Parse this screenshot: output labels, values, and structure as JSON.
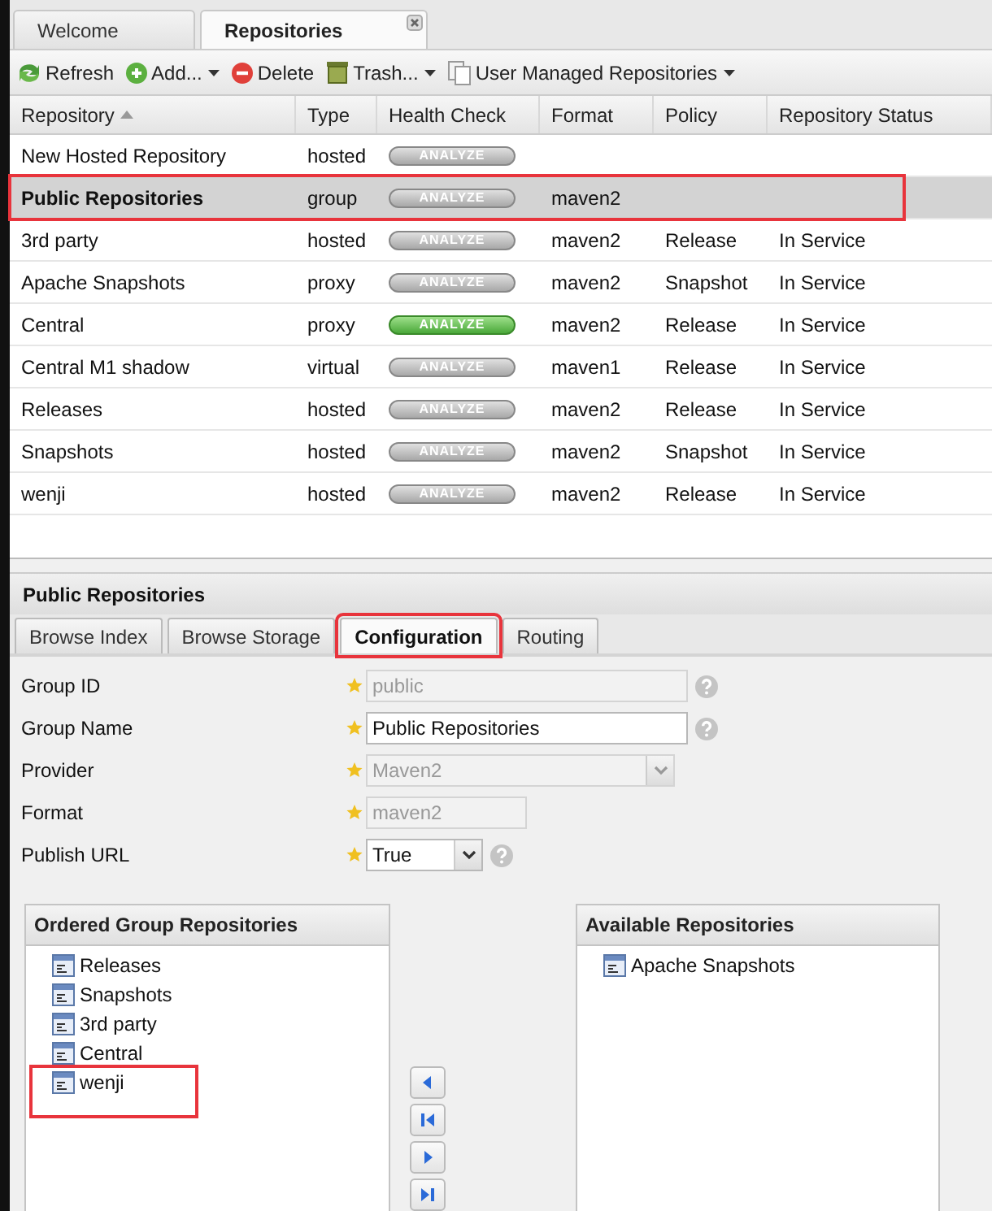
{
  "main_tabs": [
    {
      "label": "Welcome",
      "selected": false,
      "closable": false
    },
    {
      "label": "Repositories",
      "selected": true,
      "closable": true
    }
  ],
  "toolbar": [
    {
      "label": "Refresh",
      "dropdown": false
    },
    {
      "label": "Add...",
      "dropdown": true
    },
    {
      "label": "Delete",
      "dropdown": false
    },
    {
      "label": "Trash...",
      "dropdown": true
    },
    {
      "label": "User Managed Repositories",
      "dropdown": true
    }
  ],
  "table": {
    "columns": [
      {
        "label": "Repository",
        "sorted": true
      },
      {
        "label": "Type",
        "sorted": false
      },
      {
        "label": "Health Check",
        "sorted": false
      },
      {
        "label": "Format",
        "sorted": false
      },
      {
        "label": "Policy",
        "sorted": false
      },
      {
        "label": "Repository Status",
        "sorted": false
      }
    ],
    "rows": [
      {
        "repository": "New Hosted Repository",
        "type": "hosted",
        "health_check": "ANALYZE",
        "health_ok": false,
        "format": "",
        "policy": "",
        "status": "",
        "selected": false,
        "annotated": false
      },
      {
        "repository": "Public Repositories",
        "type": "group",
        "health_check": "ANALYZE",
        "health_ok": false,
        "format": "maven2",
        "policy": "",
        "status": "",
        "selected": true,
        "annotated": true
      },
      {
        "repository": "3rd party",
        "type": "hosted",
        "health_check": "ANALYZE",
        "health_ok": false,
        "format": "maven2",
        "policy": "Release",
        "status": "In Service",
        "selected": false,
        "annotated": false
      },
      {
        "repository": "Apache Snapshots",
        "type": "proxy",
        "health_check": "ANALYZE",
        "health_ok": false,
        "format": "maven2",
        "policy": "Snapshot",
        "status": "In Service",
        "selected": false,
        "annotated": false
      },
      {
        "repository": "Central",
        "type": "proxy",
        "health_check": "ANALYZE",
        "health_ok": true,
        "format": "maven2",
        "policy": "Release",
        "status": "In Service",
        "selected": false,
        "annotated": false
      },
      {
        "repository": "Central M1 shadow",
        "type": "virtual",
        "health_check": "ANALYZE",
        "health_ok": false,
        "format": "maven1",
        "policy": "Release",
        "status": "In Service",
        "selected": false,
        "annotated": false
      },
      {
        "repository": "Releases",
        "type": "hosted",
        "health_check": "ANALYZE",
        "health_ok": false,
        "format": "maven2",
        "policy": "Release",
        "status": "In Service",
        "selected": false,
        "annotated": false
      },
      {
        "repository": "Snapshots",
        "type": "hosted",
        "health_check": "ANALYZE",
        "health_ok": false,
        "format": "maven2",
        "policy": "Snapshot",
        "status": "In Service",
        "selected": false,
        "annotated": false
      },
      {
        "repository": "wenji",
        "type": "hosted",
        "health_check": "ANALYZE",
        "health_ok": false,
        "format": "maven2",
        "policy": "Release",
        "status": "In Service",
        "selected": false,
        "annotated": false
      }
    ]
  },
  "detail": {
    "title": "Public Repositories",
    "tabs": [
      {
        "label": "Browse Index",
        "selected": false,
        "annotated": false
      },
      {
        "label": "Browse Storage",
        "selected": false,
        "annotated": false
      },
      {
        "label": "Configuration",
        "selected": true,
        "annotated": true
      },
      {
        "label": "Routing",
        "selected": false,
        "annotated": false
      }
    ],
    "fields": [
      {
        "label": "Group ID",
        "kind": "text",
        "value": "public",
        "disabled": true,
        "help": true
      },
      {
        "label": "Group Name",
        "kind": "text",
        "value": "Public Repositories",
        "disabled": false,
        "help": true
      },
      {
        "label": "Provider",
        "kind": "select",
        "value": "Maven2",
        "disabled": true,
        "help": false
      },
      {
        "label": "Format",
        "kind": "short",
        "value": "maven2",
        "disabled": true,
        "help": false
      },
      {
        "label": "Publish URL",
        "kind": "small-select",
        "value": "True",
        "disabled": false,
        "help": true
      }
    ],
    "ordered": {
      "title": "Ordered Group Repositories",
      "items": [
        {
          "label": "Releases",
          "annotated": false
        },
        {
          "label": "Snapshots",
          "annotated": false
        },
        {
          "label": "3rd party",
          "annotated": false
        },
        {
          "label": "Central",
          "annotated": false
        },
        {
          "label": "wenji",
          "annotated": true
        }
      ]
    },
    "available": {
      "title": "Available Repositories",
      "items": [
        {
          "label": "Apache Snapshots",
          "annotated": false
        }
      ]
    },
    "move_buttons": [
      {
        "kind": "left"
      },
      {
        "kind": "first"
      },
      {
        "kind": "right"
      },
      {
        "kind": "last"
      }
    ]
  }
}
